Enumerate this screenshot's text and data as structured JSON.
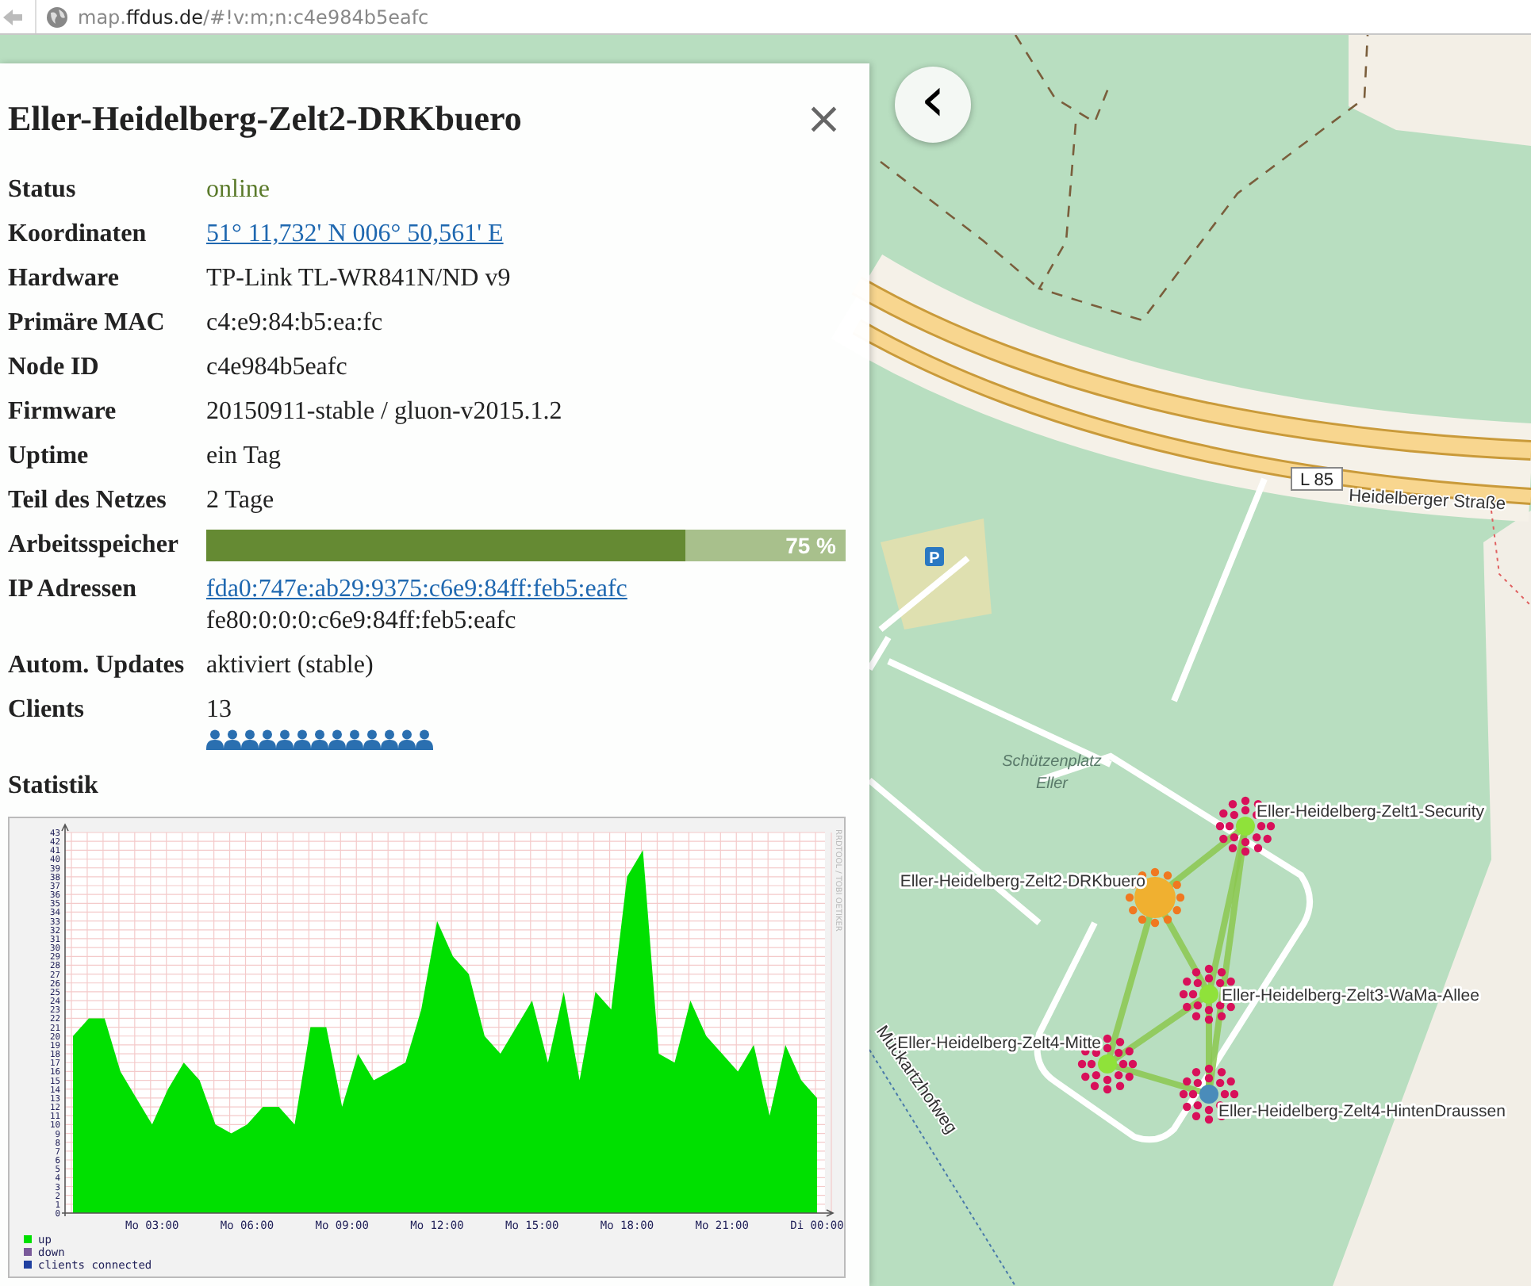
{
  "browser": {
    "url": "map.**ffdus.de**/#!v:m;n:c4e984b5eafc"
  },
  "panel": {
    "title": "Eller-Heidelberg-Zelt2-DRKbuero",
    "close": "×",
    "rows": [
      {
        "kind": "status",
        "label": "Status",
        "value": "online"
      },
      {
        "kind": "link",
        "label": "Koordinaten",
        "value": "51° 11,732' N 006° 50,561' E"
      },
      {
        "kind": "text",
        "label": "Hardware",
        "value": "TP-Link TL-WR841N/ND v9"
      },
      {
        "kind": "text",
        "label": "Primäre MAC",
        "value": "c4:e9:84:b5:ea:fc"
      },
      {
        "kind": "text",
        "label": "Node ID",
        "value": "c4e984b5eafc"
      },
      {
        "kind": "text",
        "label": "Firmware",
        "value": "20150911-stable / gluon-v2015.1.2"
      },
      {
        "kind": "text",
        "label": "Uptime",
        "value": "ein Tag"
      },
      {
        "kind": "text",
        "label": "Teil des Netzes",
        "value": "2 Tage"
      },
      {
        "kind": "meter",
        "label": "Arbeitsspeicher",
        "level": 0.75,
        "value": "75 %"
      },
      {
        "kind": "addresses",
        "label": "IP Adressen",
        "values": [
          {
            "text": "fda0:747e:ab29:9375:c6e9:84ff:feb5:eafc",
            "link": true
          },
          {
            "text": "fe80:0:0:0:c6e9:84ff:feb5:eafc",
            "link": false
          }
        ]
      },
      {
        "kind": "text",
        "label": "Autom. Updates",
        "value": "aktiviert (stable)"
      },
      {
        "kind": "clients",
        "label": "Clients",
        "value": "13"
      }
    ],
    "stats_heading": "Statistik",
    "graph": {
      "side_label": "RRDTOOL / TOBI OETIKER",
      "legend_more": [
        {
          "label": "down",
          "color": "#7a5a9a"
        },
        {
          "label": "clients connected",
          "color": "#2040a0"
        }
      ],
      "chart_data": {
        "type": "area",
        "categories": [
          null,
          null,
          null,
          null,
          null,
          "Mo 03:00",
          null,
          null,
          null,
          null,
          null,
          "Mo 06:00",
          null,
          null,
          null,
          null,
          null,
          "Mo 09:00",
          null,
          null,
          null,
          null,
          null,
          "Mo 12:00",
          null,
          null,
          null,
          null,
          null,
          "Mo 15:00",
          null,
          null,
          null,
          null,
          null,
          "Mo 18:00",
          null,
          null,
          null,
          null,
          null,
          "Mo 21:00",
          null,
          null,
          null,
          null,
          null,
          "Di 00:00"
        ],
        "series": [
          {
            "name": "up",
            "color": "#00e000",
            "values": [
              20,
              22,
              22,
              16,
              13,
              10,
              14,
              17,
              15,
              10,
              9,
              10,
              12,
              12,
              10,
              21,
              21,
              12,
              18,
              15,
              16,
              17,
              23,
              33,
              29,
              27,
              20,
              18,
              21,
              24,
              17,
              25,
              15,
              25,
              23,
              38,
              41,
              18,
              17,
              24,
              20,
              18,
              16,
              19,
              11,
              19,
              15,
              13
            ]
          }
        ],
        "ylim": [
          0,
          43
        ],
        "grid": true,
        "legend": "below left",
        "yticks": [
          0,
          1,
          2,
          3,
          4,
          5,
          6,
          7,
          8,
          9,
          10,
          11,
          12,
          13,
          14,
          15,
          16,
          17,
          18,
          19,
          20,
          21,
          22,
          23,
          24,
          25,
          26,
          27,
          28,
          29,
          30,
          31,
          32,
          33,
          34,
          35,
          36,
          37,
          38,
          39,
          40,
          41,
          42,
          43
        ]
      }
    }
  },
  "map": {
    "back": "‹",
    "places": [
      {
        "kind": "area",
        "text": "Schützenplatz"
      },
      {
        "kind": "area",
        "text": "Eller"
      },
      {
        "kind": "street",
        "text": "Heidelberger Straße"
      },
      {
        "kind": "shield",
        "text": "L 85"
      },
      {
        "kind": "path",
        "text": "Mückartzhofweg"
      },
      {
        "kind": "parking",
        "text": "P"
      }
    ],
    "nodes": [
      {
        "label": "Eller-Heidelberg-Zelt1-Security",
        "selected": false,
        "color": "#8fe23a"
      },
      {
        "label": "Eller-Heidelberg-Zelt2-DRKbuero",
        "selected": true,
        "color": "#f0b030"
      },
      {
        "label": "Eller-Heidelberg-Zelt3-WaMa-Allee",
        "selected": false,
        "color": "#8fe23a"
      },
      {
        "label": "Eller-Heidelberg-Zelt4-Mitte",
        "selected": false,
        "color": "#8fe23a"
      },
      {
        "label": "Eller-Heidelberg-Zelt4-HintenDraussen",
        "selected": false,
        "color": "#4a8cba"
      }
    ]
  }
}
